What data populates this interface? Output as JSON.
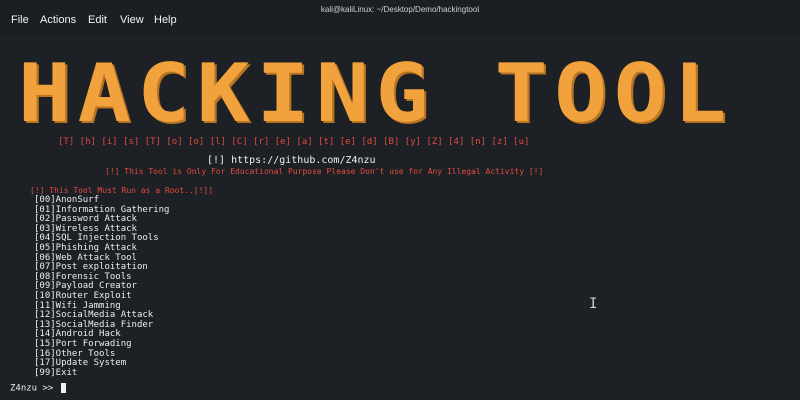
{
  "window": {
    "title": "kali@kaliLinux: ~/Desktop/Demo/hackingtool"
  },
  "menu": [
    "File",
    "Actions",
    "Edit",
    "View",
    "Help"
  ],
  "banner": {
    "text": "HACKING TOOL",
    "color": "#f2a23c",
    "letters": "[T] [h] [i] [s]  [T] [o] [o] [l]  [C] [r] [e] [a] [t] [e] [d]  [B] [y]  [Z] [4] [n] [z] [u]"
  },
  "info": {
    "github": "[!] https://github.com/Z4nzu",
    "warning": "[!] This Tool is Only For Educational Purpose Please Don't use for Any Illegal Activity [!]",
    "root_warning": "[!] This Tool Must Run as a Root..[!]]"
  },
  "options": [
    "[00]AnonSurf",
    "[01]Information Gathering",
    "[02]Password Attack",
    "[03]Wireless Attack",
    "[04]SQL Injection Tools",
    "[05]Phishing Attack",
    "[06]Web Attack Tool",
    "[07]Post exploitation",
    "[08]Forensic Tools",
    "[09]Payload Creator",
    "[10]Router Exploit",
    "[11]Wifi Jamming",
    "[12]SocialMedia Attack",
    "[13]SocialMedia Finder",
    "[14]Android Hack",
    "[15]Port Forwading",
    "[16]Other Tools",
    "[17]Update System",
    "[99]Exit"
  ],
  "prompt": {
    "text": "Z4nzu >> "
  },
  "colors": {
    "background": "#1d2025",
    "accent": "#f2a23c",
    "warning": "#e24b3f"
  }
}
